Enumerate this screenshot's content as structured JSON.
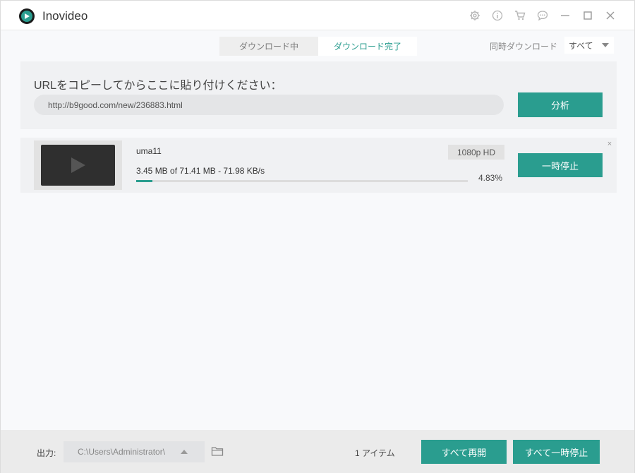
{
  "app": {
    "title": "Inovideo",
    "accent_color": "#2a9d8f",
    "titlebar_icons": [
      "settings-icon",
      "info-icon",
      "cart-icon",
      "chat-icon",
      "minimize-icon",
      "maximize-icon",
      "close-icon"
    ]
  },
  "tabs": [
    {
      "label": "ダウンロード中",
      "active": false
    },
    {
      "label": "ダウンロード完了",
      "active": true
    }
  ],
  "concurrent": {
    "label": "同時ダウンロード",
    "selected": "すべて"
  },
  "url_panel": {
    "prompt": "URLをコピーしてからここに貼り付けください：",
    "value": "http://b9good.com/new/236883.html",
    "analyze_label": "分析"
  },
  "downloads": [
    {
      "name": "uma11",
      "quality": "1080p HD",
      "progress_text": "3.45 MB of 71.41 MB - 71.98 KB/s",
      "percent_label": "4.83%",
      "percent": 4.83,
      "pause_label": "一時停止",
      "close_label": "×"
    }
  ],
  "footer": {
    "output_label": "出力:",
    "output_path": "C:\\Users\\Administrator\\",
    "item_count": "1 アイテム",
    "resume_all_label": "すべて再開",
    "pause_all_label": "すべて一時停止"
  }
}
